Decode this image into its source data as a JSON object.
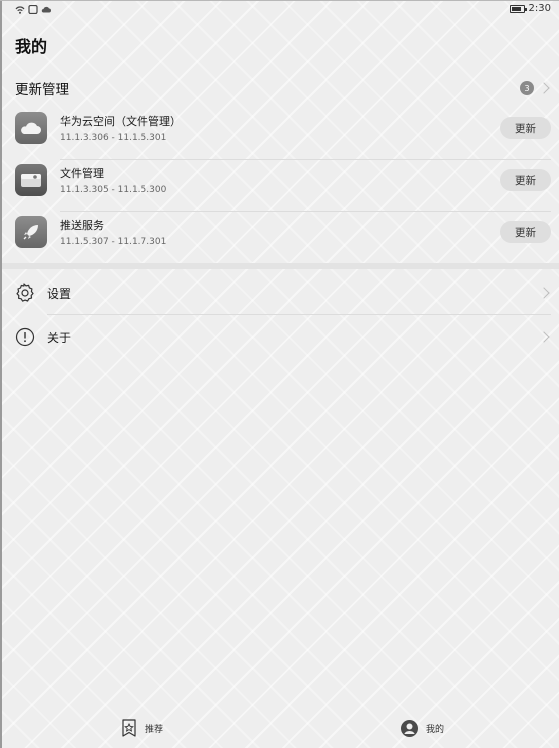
{
  "status_bar": {
    "time": "2:30",
    "icons": [
      "wifi-icon",
      "notification-icon",
      "cloud-icon",
      "battery-icon"
    ]
  },
  "page": {
    "title": "我的"
  },
  "updates": {
    "title": "更新管理",
    "count": "3",
    "items": [
      {
        "name": "华为云空间（文件管理）",
        "version": "11.1.3.306 - 11.1.5.301",
        "button": "更新",
        "icon": "cloud-icon"
      },
      {
        "name": "文件管理",
        "version": "11.1.3.305 - 11.1.5.300",
        "button": "更新",
        "icon": "folder-icon"
      },
      {
        "name": "推送服务",
        "version": "11.1.5.307 - 11.1.7.301",
        "button": "更新",
        "icon": "rocket-icon"
      }
    ]
  },
  "menu": [
    {
      "label": "设置",
      "icon": "gear-icon"
    },
    {
      "label": "关于",
      "icon": "info-icon"
    }
  ],
  "bottom_nav": [
    {
      "label": "推荐",
      "icon": "recommend-icon"
    },
    {
      "label": "我的",
      "icon": "profile-icon"
    }
  ]
}
